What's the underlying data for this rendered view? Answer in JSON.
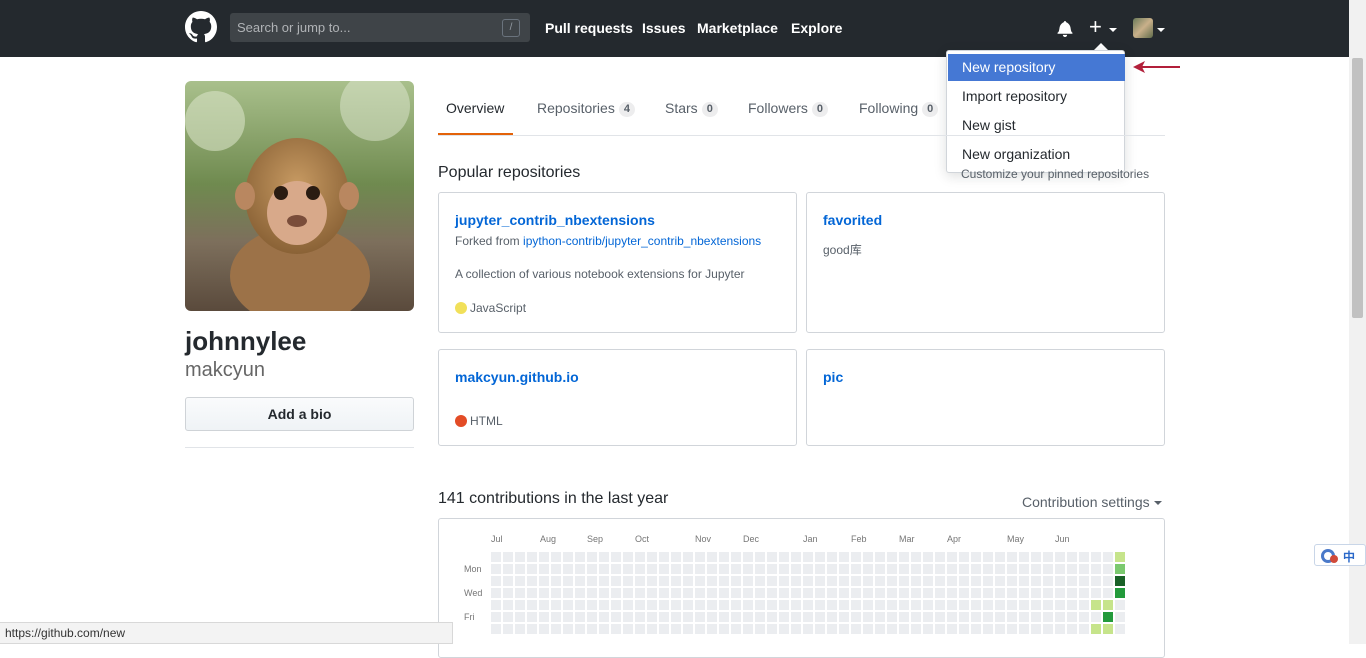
{
  "header": {
    "search_placeholder": "Search or jump to...",
    "search_key": "/",
    "nav": [
      "Pull requests",
      "Issues",
      "Marketplace",
      "Explore"
    ]
  },
  "dropdown": {
    "items": [
      "New repository",
      "Import repository",
      "New gist",
      "New organization"
    ]
  },
  "profile": {
    "fullname": "johnnylee",
    "username": "makcyun",
    "bio_button": "Add a bio"
  },
  "tabs": [
    {
      "label": "Overview",
      "count": ""
    },
    {
      "label": "Repositories",
      "count": "4"
    },
    {
      "label": "Stars",
      "count": "0"
    },
    {
      "label": "Followers",
      "count": "0"
    },
    {
      "label": "Following",
      "count": "0"
    }
  ],
  "popular": {
    "title": "Popular repositories",
    "customize": "Customize your pinned repositories",
    "repos": [
      {
        "name": "jupyter_contrib_nbextensions",
        "forked_prefix": "Forked from",
        "forked_from": "ipython-contrib/jupyter_contrib_nbextensions",
        "description": "A collection of various notebook extensions for Jupyter",
        "language": "JavaScript",
        "language_color": "#f1e05a"
      },
      {
        "name": "favorited",
        "description": "good库"
      },
      {
        "name": "makcyun.github.io",
        "language": "HTML",
        "language_color": "#e34c26"
      },
      {
        "name": "pic"
      }
    ]
  },
  "contributions": {
    "title": "141 contributions in the last year",
    "settings": "Contribution settings",
    "months": [
      "Jul",
      "Aug",
      "Sep",
      "Oct",
      "Nov",
      "Dec",
      "Jan",
      "Feb",
      "Mar",
      "Apr",
      "May",
      "Jun"
    ],
    "days": [
      "Mon",
      "Wed",
      "Fri"
    ],
    "colors": [
      "#ebedf0",
      "#c6e48b",
      "#7bc96f",
      "#239a3b",
      "#196127"
    ],
    "last_weeks": [
      [
        0,
        0,
        0,
        0,
        0,
        0,
        0
      ],
      [
        0,
        0,
        0,
        0,
        1,
        0,
        1
      ],
      [
        0,
        0,
        0,
        0,
        1,
        3,
        1
      ],
      [
        1,
        2,
        4,
        3,
        0,
        0,
        0
      ]
    ]
  },
  "status_bar": "https://github.com/new",
  "ime": "中"
}
